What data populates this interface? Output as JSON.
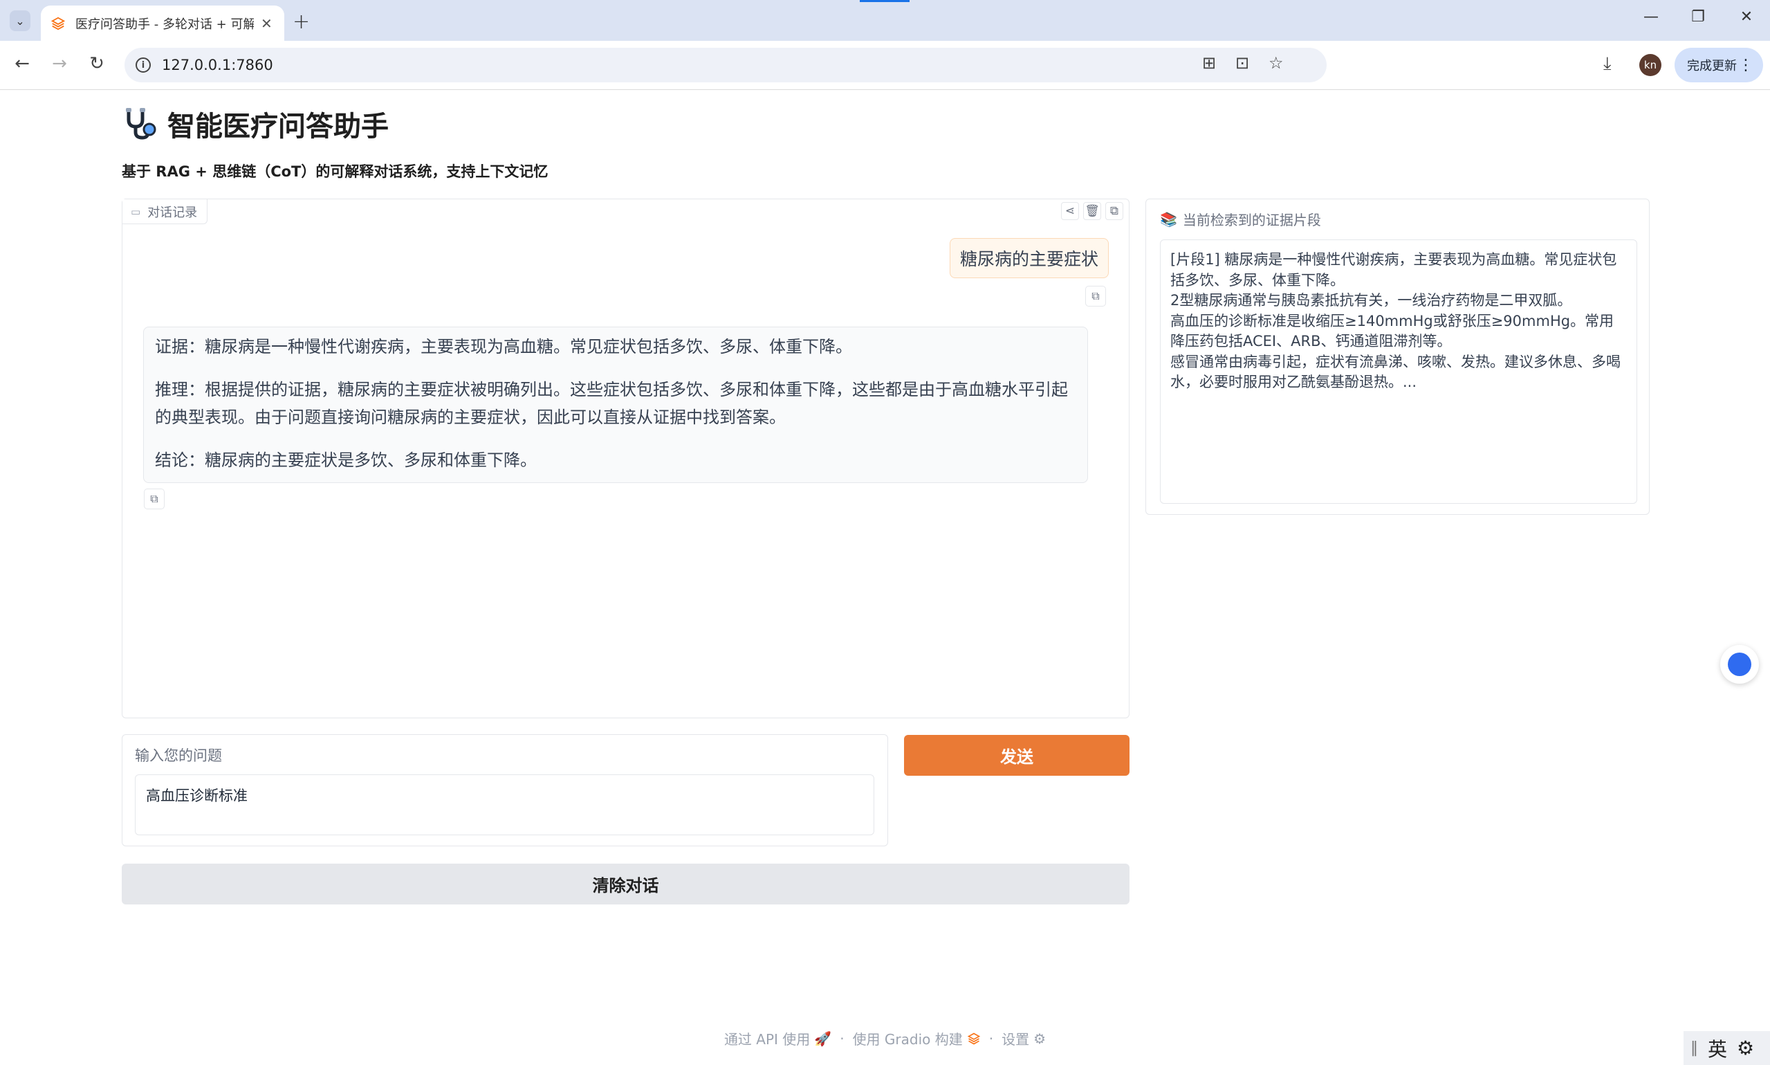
{
  "browser": {
    "tab_title": "医疗问答助手 - 多轮对话 + 可解",
    "url": "127.0.0.1:7860",
    "update_label": "完成更新",
    "avatar_initials": "kn"
  },
  "app": {
    "title": "智能医疗问答助手",
    "subtitle": "基于 RAG + 思维链（CoT）的可解释对话系统，支持上下文记忆"
  },
  "chat": {
    "label": "对话记录",
    "user_message": "糖尿病的主要症状",
    "bot_message": {
      "evidence": "证据：糖尿病是一种慢性代谢疾病，主要表现为高血糖。常见症状包括多饮、多尿、体重下降。",
      "reasoning": "推理：根据提供的证据，糖尿病的主要症状被明确列出。这些症状包括多饮、多尿和体重下降，这些都是由于高血糖水平引起的典型表现。由于问题直接询问糖尿病的主要症状，因此可以直接从证据中找到答案。",
      "conclusion": "结论：糖尿病的主要症状是多饮、多尿和体重下降。"
    }
  },
  "evidence": {
    "label": "当前检索到的证据片段",
    "content": "[片段1] 糖尿病是一种慢性代谢疾病，主要表现为高血糖。常见症状包括多饮、多尿、体重下降。\n2型糖尿病通常与胰岛素抵抗有关，一线治疗药物是二甲双胍。\n高血压的诊断标准是收缩压≥140mmHg或舒张压≥90mmHg。常用降压药包括ACEI、ARB、钙通道阻滞剂等。\n感冒通常由病毒引起，症状有流鼻涕、咳嗽、发热。建议多休息、多喝水，必要时服用对乙酰氨基酚退热。..."
  },
  "input": {
    "label": "输入您的问题",
    "value": "高血压诊断标准"
  },
  "buttons": {
    "send": "发送",
    "clear": "清除对话"
  },
  "footer": {
    "api": "通过 API 使用",
    "built_with": "使用 Gradio 构建",
    "settings": "设置",
    "dot": "·"
  },
  "ime": {
    "mode": "英"
  },
  "colors": {
    "accent": "#ea7a35",
    "tabbar": "#dbe3f3",
    "float_button": "#2f6bf0"
  }
}
